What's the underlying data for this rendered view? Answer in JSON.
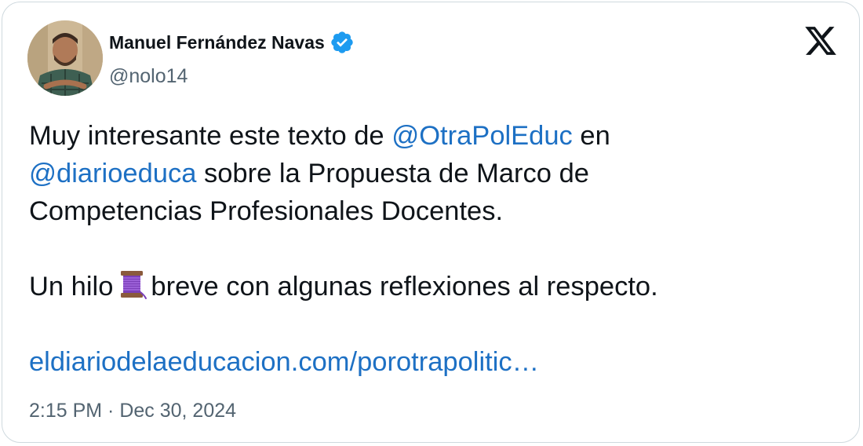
{
  "author": {
    "display_name": "Manuel Fernández Navas",
    "handle": "@nolo14",
    "verified": true
  },
  "tweet": {
    "line1_pre": "Muy interesante este texto de ",
    "line1_mention": "@OtraPolEduc",
    "line1_post": " en",
    "line2_mention": "@diarioeduca",
    "line2_post": " sobre la Propuesta de Marco de",
    "line3": "Competencias Profesionales Docentes.",
    "line4_pre": "Un hilo",
    "thread_icon": "thread-spool-icon",
    "line4_post": "breve con algunas reflexiones al respecto.",
    "link": "eldiariodelaeducacion.com/porotrapolitic…"
  },
  "meta": {
    "timestamp": "2:15 PM · Dec 30, 2024"
  },
  "icons": {
    "verified": "verified-badge-icon",
    "brand": "x-logo-icon"
  },
  "colors": {
    "text": "#0f1419",
    "secondary": "#536471",
    "link": "#1d70c4",
    "verified": "#1d9bf0",
    "border": "#cfd9de"
  }
}
